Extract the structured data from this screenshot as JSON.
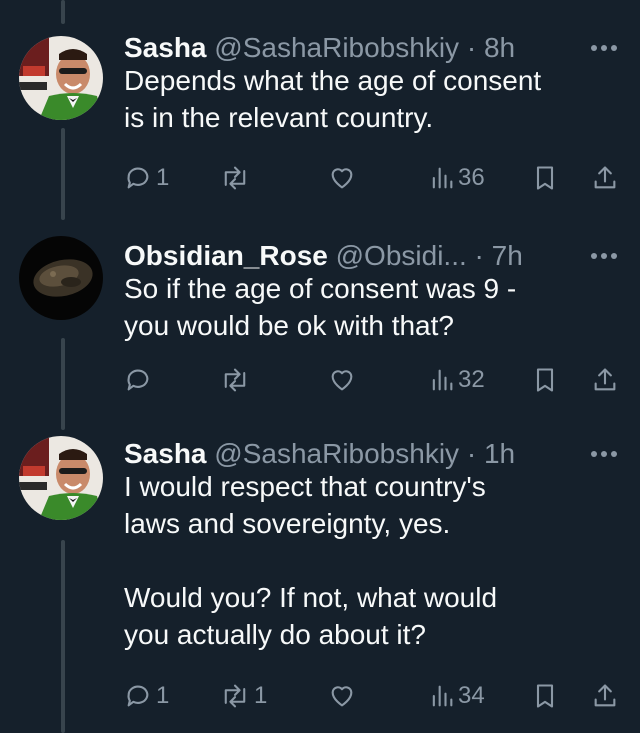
{
  "tweets": [
    {
      "name": "Sasha",
      "handle": "@SashaRibobshkiy",
      "time": "· 8h",
      "text": [
        "Depends what the age of consent",
        "is in the relevant country."
      ],
      "replies": "1",
      "retweets": "",
      "likes": "",
      "views": "36"
    },
    {
      "name": "Obsidian_Rose",
      "handle": "@Obsidi...",
      "time": "· 7h",
      "text": [
        "So if the age of consent was 9 -",
        "you would be ok with that?"
      ],
      "replies": "",
      "retweets": "",
      "likes": "",
      "views": "32"
    },
    {
      "name": "Sasha",
      "handle": "@SashaRibobshkiy",
      "time": "· 1h",
      "text": [
        "I would respect that country's",
        "laws and sovereignty, yes.",
        "Would you?  If not, what would",
        "you actually do about it?"
      ],
      "replies": "1",
      "retweets": "1",
      "likes": "",
      "views": "34"
    }
  ],
  "colors": {
    "background": "#15202b",
    "text": "#f7f9f9",
    "secondary": "#8b98a5",
    "thread_line": "#38444d"
  },
  "icons": {
    "reply": "reply-icon",
    "retweet": "retweet-icon",
    "like": "heart-icon",
    "views": "views-icon",
    "bookmark": "bookmark-icon",
    "share": "share-icon",
    "more": "more-icon"
  }
}
